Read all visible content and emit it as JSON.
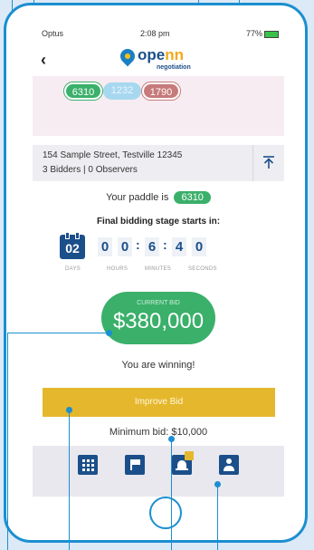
{
  "status_bar": {
    "carrier": "Optus",
    "time": "2:08 pm",
    "battery": "77%"
  },
  "header": {
    "back_icon": "chevron-left-icon",
    "logo_word_prefix": "ope",
    "logo_word_suffix": "nn",
    "logo_sub": "negotiation"
  },
  "paddles": [
    {
      "number": "6310",
      "color": "#3ab06a"
    },
    {
      "number": "1232",
      "color": "#a8d8f0"
    },
    {
      "number": "1790",
      "color": "#c77a7a"
    }
  ],
  "property": {
    "address": "154 Sample Street, Testville 12345",
    "bidders": "3 Bidders | 0 Observers"
  },
  "your_paddle": {
    "label": "Your paddle is",
    "number": "6310"
  },
  "countdown": {
    "title": "Final bidding stage starts in:",
    "days": "02",
    "digits": [
      "0",
      "0",
      "6",
      "4",
      "0"
    ],
    "labels": {
      "days": "DAYS",
      "hours": "HOURS",
      "minutes": "MINUTES",
      "seconds": "SECONDS"
    }
  },
  "bid": {
    "label": "CURRENT BID",
    "amount": "$380,000",
    "status": "You are winning!"
  },
  "actions": {
    "improve_label": "Improve Bid",
    "minimum_bid": "Minimum bid: $10,000"
  },
  "tabs": [
    {
      "icon": "grid-icon"
    },
    {
      "icon": "flag-icon"
    },
    {
      "icon": "bell-icon"
    },
    {
      "icon": "user-icon"
    }
  ],
  "colors": {
    "accent": "#1b8fd0",
    "brand": "#1b4f8a",
    "success": "#3ab06a",
    "warning": "#e5b72c"
  }
}
